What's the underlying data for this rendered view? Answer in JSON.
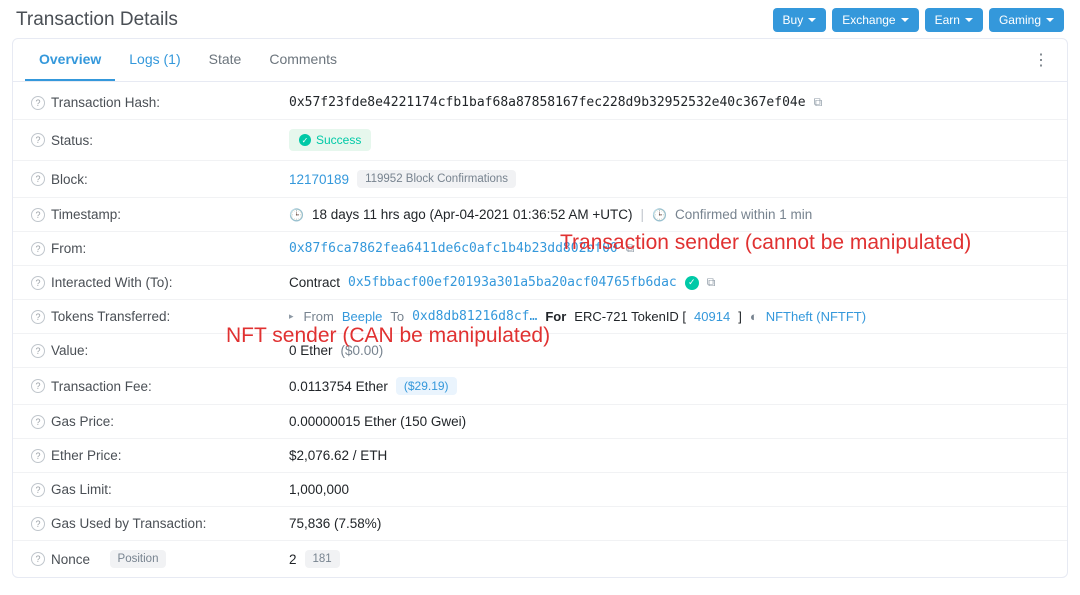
{
  "header": {
    "title": "Transaction Details",
    "buttons": {
      "buy": "Buy",
      "exchange": "Exchange",
      "earn": "Earn",
      "gaming": "Gaming"
    }
  },
  "tabs": {
    "overview": "Overview",
    "logs": "Logs (1)",
    "state": "State",
    "comments": "Comments"
  },
  "labels": {
    "hash": "Transaction Hash:",
    "status": "Status:",
    "block": "Block:",
    "timestamp": "Timestamp:",
    "from": "From:",
    "to": "Interacted With (To):",
    "tokens": "Tokens Transferred:",
    "value": "Value:",
    "fee": "Transaction Fee:",
    "gasprice": "Gas Price:",
    "etherprice": "Ether Price:",
    "gaslimit": "Gas Limit:",
    "gasused": "Gas Used by Transaction:",
    "nonce": "Nonce",
    "position": "Position"
  },
  "values": {
    "hash": "0x57f23fde8e4221174cfb1baf68a87858167fec228d9b32952532e40c367ef04e",
    "status": "Success",
    "block": "12170189",
    "confirmations": "119952 Block Confirmations",
    "timestamp_main": "18 days 11 hrs ago (Apr-04-2021 01:36:52 AM +UTC)",
    "timestamp_confirm": "Confirmed within 1 min",
    "from": "0x87f6ca7862fea6411de6c0afc1b4b23dd802bf00",
    "to_prefix": "Contract",
    "to": "0x5fbbacf00ef20193a301a5ba20acf04765fb6dac",
    "tokens_from_lbl": "From",
    "tokens_from": "Beeple",
    "tokens_to_lbl": "To",
    "tokens_to": "0xd8db81216d8cf…",
    "tokens_for": "For",
    "tokens_std": "ERC-721 TokenID [",
    "tokens_id": "40914",
    "tokens_std_close": "]",
    "tokens_nft": "NFTheft (NFTFT)",
    "value_amount": "0 Ether",
    "value_usd": "($0.00)",
    "fee_amount": "0.0113754 Ether",
    "fee_usd": "($29.19)",
    "gasprice": "0.00000015 Ether (150 Gwei)",
    "etherprice": "$2,076.62 / ETH",
    "gaslimit": "1,000,000",
    "gasused": "75,836 (7.58%)",
    "nonce": "2",
    "position": "181"
  },
  "annotations": {
    "a1": "Transaction sender (cannot be manipulated)",
    "a2": "NFT sender (CAN be manipulated)"
  }
}
